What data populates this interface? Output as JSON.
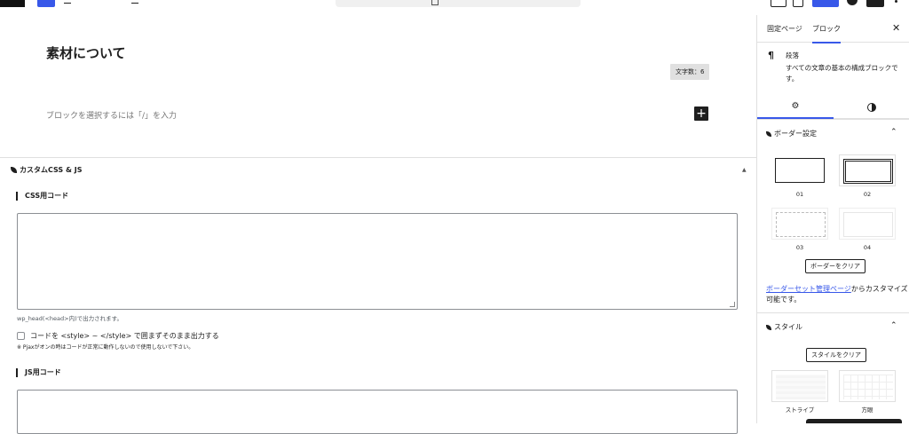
{
  "toolbar": {
    "icons": [
      "wordpress-logo-icon",
      "add-block-icon",
      "edit-tool-icon",
      "undo-icon",
      "redo-icon",
      "list-view-icon",
      "document-icon",
      "preview-icon",
      "publish-button",
      "avatar-icon",
      "settings-sidebar-icon",
      "more-icon"
    ]
  },
  "editor": {
    "title": "素材について",
    "word_count": "文字数：6",
    "block_placeholder": "ブロックを選択するには「/」を入力",
    "add_block_symbol": "+"
  },
  "metabox": {
    "title": "カスタムCSS & JS",
    "toggle_symbol": "▲",
    "css_label": "CSS用コード",
    "css_hint": "wp_head(<head>内)で出力されます。",
    "checkbox_label": "コードを <style> ~ </style> で囲まずそのまま出力する",
    "pjax_note": "※ Pjaxがオンの時はコードが正常に動作しないので使用しないで下さい。",
    "js_label": "JS用コード"
  },
  "sidebar": {
    "tabs": [
      "固定ページ",
      "ブロック"
    ],
    "close_symbol": "✕",
    "block": {
      "icon_symbol": "¶",
      "name": "段落",
      "description": "すべての文章の基本の構成ブロックです。"
    },
    "border_panel": {
      "title": "ボーダー設定",
      "chevron": "⌃",
      "options": [
        "01",
        "02",
        "03",
        "04"
      ],
      "clear_button": "ボーダーをクリア",
      "link_text": "ボーダーセット管理ページ",
      "after_link": "からカスタマイズ可能です。"
    },
    "style_panel": {
      "title": "スタイル",
      "chevron": "⌃",
      "clear_button": "スタイルをクリア",
      "options": [
        "ストライプ",
        "方眼"
      ]
    }
  },
  "colors": {
    "accent": "#3858e9",
    "text": "#1e1e1e",
    "muted": "#757575"
  }
}
